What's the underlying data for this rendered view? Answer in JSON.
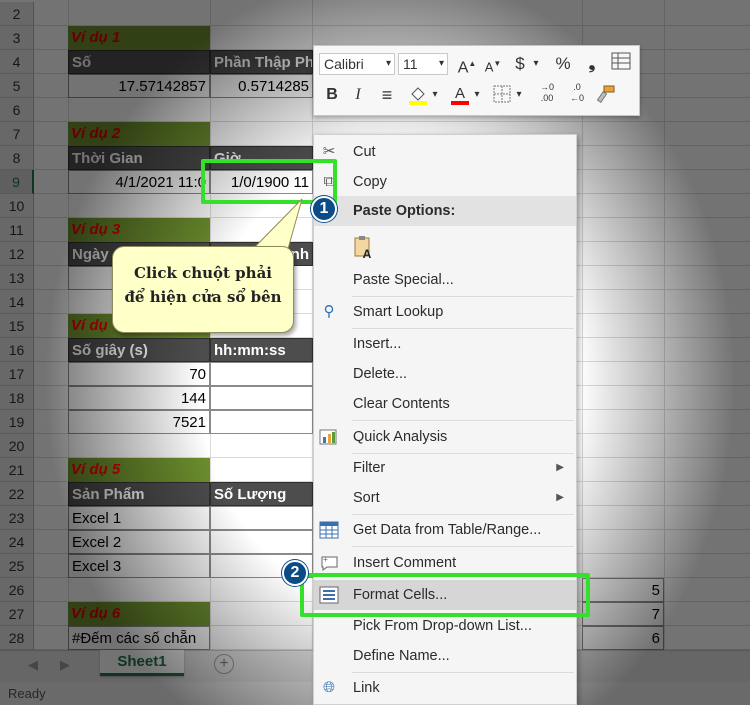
{
  "rows": [
    "2",
    "3",
    "4",
    "5",
    "6",
    "7",
    "8",
    "9",
    "10",
    "11",
    "12",
    "13",
    "14",
    "15",
    "16",
    "17",
    "18",
    "19",
    "20",
    "21",
    "22",
    "23",
    "24",
    "25",
    "26",
    "27",
    "28"
  ],
  "cells": {
    "vd1": "Ví dụ 1",
    "so": "Số",
    "phan_thap_phan": "Phần Thập Ph",
    "so_val": "17.57142857",
    "ptp_val": "0.5714285",
    "vd2": "Ví dụ 2",
    "thoi_gian": "Thời Gian",
    "gio": "Giờ",
    "tg_val": "4/1/2021 11:0",
    "gio_val": "1/0/1900 11",
    "vd3": "Ví dụ 3",
    "ngay": "Ngày",
    "vd3_col2": "nh",
    "vd4": "Ví dụ",
    "so_giay": "Số giây (s)",
    "hhmmss": "hh:mm:ss",
    "sg1": "70",
    "sg2": "144",
    "sg3": "7521",
    "vd5": "Ví dụ 5",
    "san_pham": "Sản Phẩm",
    "so_luong": "Số Lượng",
    "sp1": "Excel 1",
    "sp2": "Excel 2",
    "sp3": "Excel 3",
    "r26": "5",
    "r27": "7",
    "r28": "6",
    "vd6": "Ví dụ 6",
    "dem": "#Đếm các số chẵn"
  },
  "mini_toolbar": {
    "font": "Calibri",
    "size": "11",
    "grow": "A",
    "shrink": "A",
    "currency": "$",
    "percent": "%",
    "comma": "❟",
    "bold": "B",
    "italic": "I",
    "align": "≡",
    "inc_dec": ".00",
    "dec_dec": ".0",
    "inc_sub": "→0",
    "dec_sub": "←0",
    "dd": "▾",
    "fill_color": "#ffff00",
    "font_color": "#ff0000"
  },
  "menu": {
    "cut": "Cut",
    "copy": "Copy",
    "paste_options": "Paste Options:",
    "paste_special": "Paste Special...",
    "smart_lookup": "Smart Lookup",
    "insert": "Insert...",
    "delete": "Delete...",
    "clear_contents": "Clear Contents",
    "quick_analysis": "Quick Analysis",
    "filter": "Filter",
    "sort": "Sort",
    "get_data": "Get Data from Table/Range...",
    "insert_comment": "Insert Comment",
    "format_cells": "Format Cells...",
    "pick_list": "Pick From Drop-down List...",
    "define_name": "Define Name...",
    "link": "Link",
    "submenu_arrow": "▶"
  },
  "callout": {
    "line1": "Click chuột phải",
    "line2": "để hiện cửa sổ bên"
  },
  "badges": {
    "one": "1",
    "two": "2"
  },
  "sheet_tab": "Sheet1",
  "status": "Ready"
}
